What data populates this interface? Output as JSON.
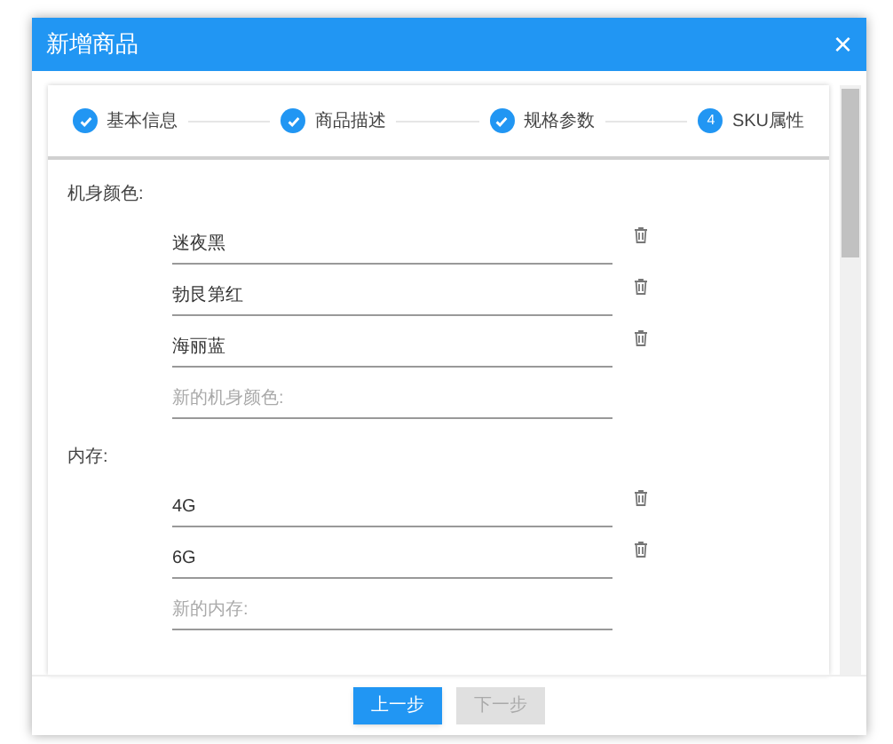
{
  "dialog": {
    "title": "新增商品",
    "close": "×"
  },
  "steps": [
    {
      "label": "基本信息",
      "completed": true
    },
    {
      "label": "商品描述",
      "completed": true
    },
    {
      "label": "规格参数",
      "completed": true
    },
    {
      "label": "SKU属性",
      "number": "4",
      "completed": false
    }
  ],
  "sections": [
    {
      "label": "机身颜色:",
      "options": [
        "迷夜黑",
        "勃艮第红",
        "海丽蓝"
      ],
      "placeholder": "新的机身颜色:"
    },
    {
      "label": "内存:",
      "options": [
        "4G",
        "6G"
      ],
      "placeholder": "新的内存:"
    }
  ],
  "buttons": [
    {
      "label": "上一步",
      "disabled": false
    },
    {
      "label": "下一步",
      "disabled": true
    }
  ]
}
